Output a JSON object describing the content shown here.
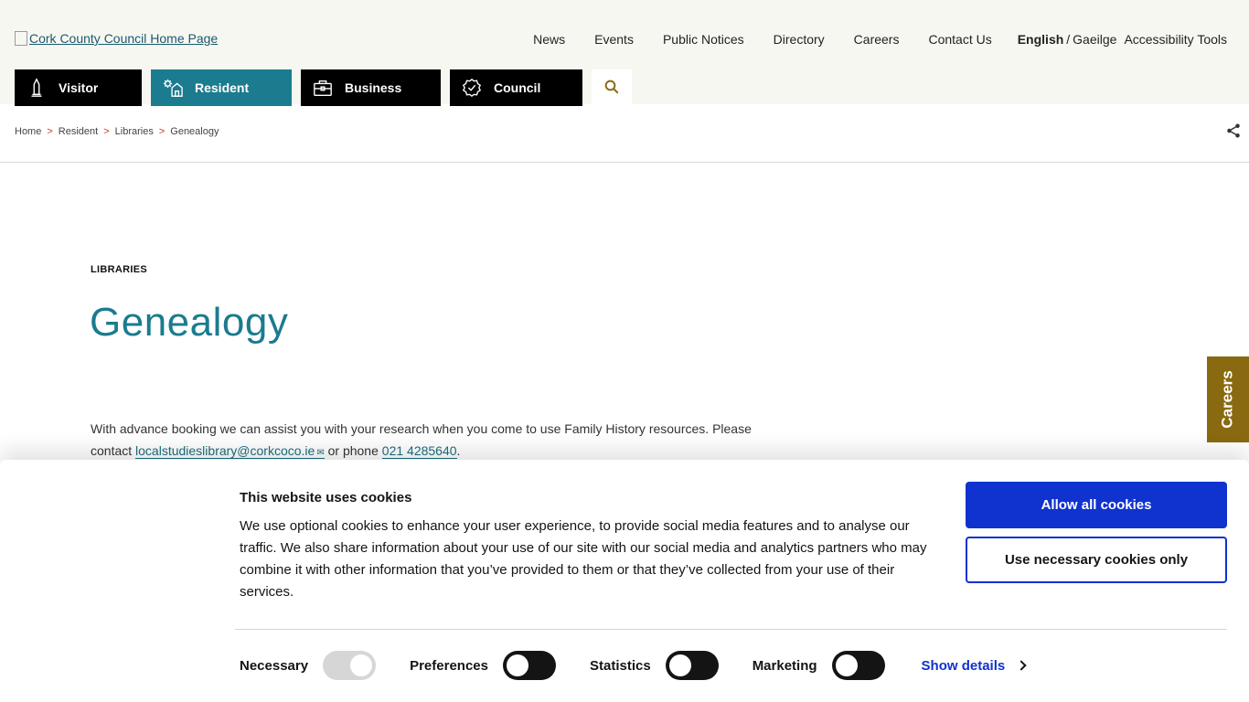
{
  "header": {
    "logo_alt": "Cork County Council Home Page",
    "nav": [
      "News",
      "Events",
      "Public Notices",
      "Directory",
      "Careers",
      "Contact Us"
    ],
    "lang_english": "English",
    "lang_sep": "/",
    "lang_irish": "Gaeilge",
    "accessibility": "Accessibility Tools",
    "audience": [
      {
        "label": "Visitor",
        "icon": "monument-icon"
      },
      {
        "label": "Resident",
        "icon": "house-gear-icon"
      },
      {
        "label": "Business",
        "icon": "briefcase-icon"
      },
      {
        "label": "Council",
        "icon": "seal-check-icon"
      }
    ],
    "active_audience": "Resident",
    "search_icon": "search-icon"
  },
  "breadcrumb": [
    "Home",
    "Resident",
    "Libraries",
    "Genealogy"
  ],
  "breadcrumb_sep": ">",
  "main": {
    "section_label": "LIBRARIES",
    "title": "Genealogy",
    "intro_before": "With advance booking we can assist you with your research when you come to use Family History resources. Please contact ",
    "email": "localstudieslibrary@corkcoco.ie",
    "intro_mid": " or phone ",
    "phone": "021 4285640",
    "intro_end": "."
  },
  "careers_tab": "Careers",
  "cookie": {
    "title": "This website uses cookies",
    "text": "We use optional cookies to enhance your user experience, to provide social media features and to analyse our traffic. We also share information about your use of our site with our social media and analytics partners who may combine it with other information that you’ve provided to them or that they’ve collected from your use of their services.",
    "allow_label": "Allow all cookies",
    "necessary_label": "Use necessary cookies only",
    "toggles": {
      "necessary": "Necessary",
      "preferences": "Preferences",
      "statistics": "Statistics",
      "marketing": "Marketing"
    },
    "show_details": "Show details"
  },
  "colors": {
    "teal": "#1b7b8f",
    "gold": "#8a6a10",
    "cookie_blue": "#1032cf"
  }
}
